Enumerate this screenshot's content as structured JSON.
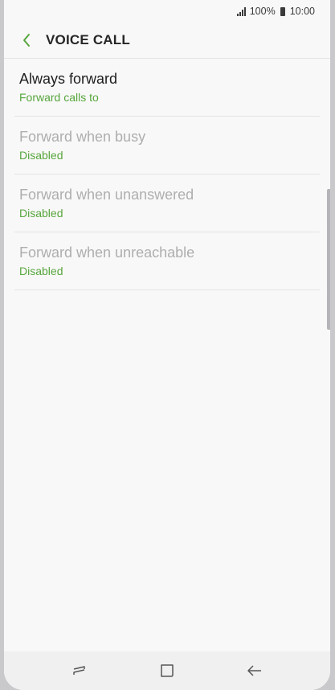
{
  "status_bar": {
    "battery_text": "100%",
    "time": "10:00",
    "icons": [
      "signal-icon",
      "battery-icon"
    ]
  },
  "header": {
    "title": "VOICE CALL",
    "back_icon": "chevron-left-icon",
    "accent_color": "#56a63d"
  },
  "items": [
    {
      "title": "Always forward",
      "subtitle": "Forward calls to",
      "enabled": true
    },
    {
      "title": "Forward when busy",
      "subtitle": "Disabled",
      "enabled": false
    },
    {
      "title": "Forward when unanswered",
      "subtitle": "Disabled",
      "enabled": false
    },
    {
      "title": "Forward when unreachable",
      "subtitle": "Disabled",
      "enabled": false
    }
  ],
  "nav_bar": {
    "icons": [
      "recent-apps-icon",
      "home-icon",
      "back-icon"
    ]
  }
}
